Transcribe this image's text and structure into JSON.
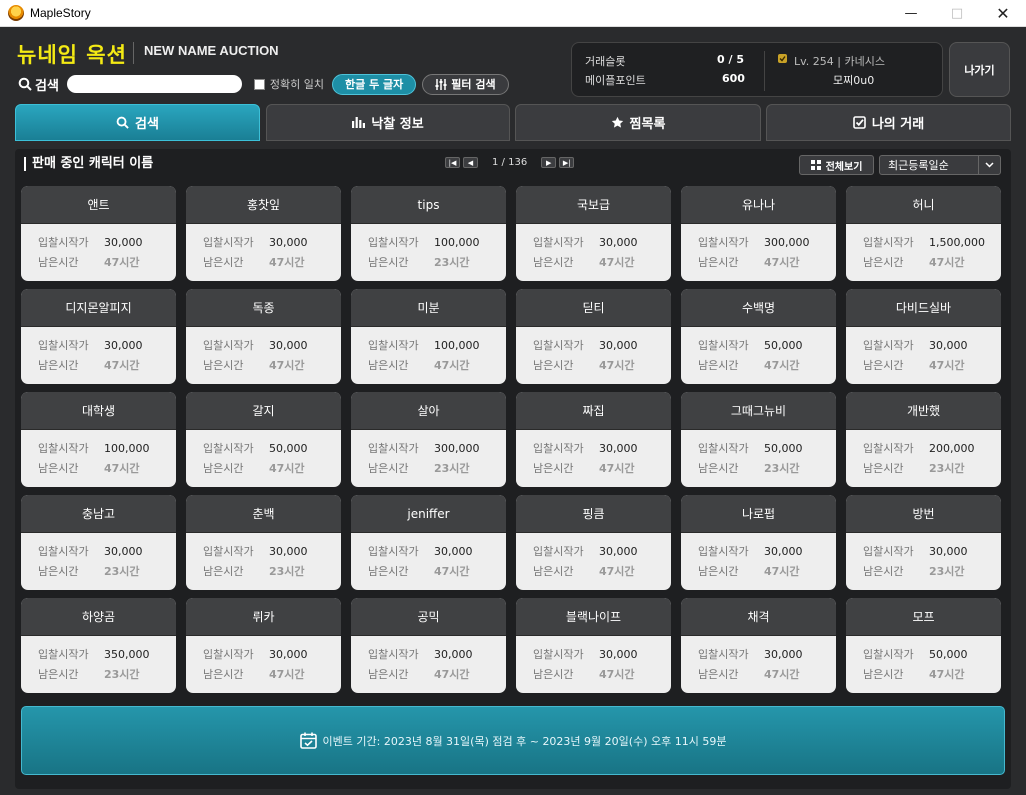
{
  "window": {
    "title": "MapleStory"
  },
  "header": {
    "title": "뉴네임 옥션",
    "subtitle": "NEW NAME AUCTION",
    "search_label": "검색",
    "search_value": "",
    "exact_match_label": "정확히 일치",
    "hangul_two_chars_label": "한글 두 글자",
    "filter_search_label": "필터 검색"
  },
  "info": {
    "trade_slot_label": "거래슬롯",
    "trade_slot_value": "0 / 5",
    "maple_points_label": "메이플포인트",
    "maple_points_value": "600",
    "character_level": "Lv. 254 | 카네시스",
    "character_name": "모찌0u0",
    "exit_label": "나가기"
  },
  "tabs": [
    {
      "label": "검색",
      "icon": "search-icon",
      "active": true
    },
    {
      "label": "낙찰 정보",
      "icon": "bar-chart-icon",
      "active": false
    },
    {
      "label": "찜목록",
      "icon": "star-icon",
      "active": false
    },
    {
      "label": "나의 거래",
      "icon": "checkbox-icon",
      "active": false
    }
  ],
  "list": {
    "title": "판매 중인 캐릭터 이름",
    "page_text": "1 / 136",
    "view_all_label": "전체보기",
    "sort_value": "최근등록일순",
    "bid_label": "입찰시작가",
    "time_label": "남은시간",
    "items": [
      {
        "name": "앤트",
        "price": "30,000",
        "time": "47시간"
      },
      {
        "name": "홍찻잎",
        "price": "30,000",
        "time": "47시간"
      },
      {
        "name": "tips",
        "price": "100,000",
        "time": "23시간"
      },
      {
        "name": "국보급",
        "price": "30,000",
        "time": "47시간"
      },
      {
        "name": "유나나",
        "price": "300,000",
        "time": "47시간"
      },
      {
        "name": "허니",
        "price": "1,500,000",
        "time": "47시간"
      },
      {
        "name": "디지몬알피지",
        "price": "30,000",
        "time": "47시간"
      },
      {
        "name": "독종",
        "price": "30,000",
        "time": "47시간"
      },
      {
        "name": "미분",
        "price": "100,000",
        "time": "47시간"
      },
      {
        "name": "딛티",
        "price": "30,000",
        "time": "47시간"
      },
      {
        "name": "수백명",
        "price": "50,000",
        "time": "47시간"
      },
      {
        "name": "다비드실바",
        "price": "30,000",
        "time": "47시간"
      },
      {
        "name": "대학생",
        "price": "100,000",
        "time": "47시간"
      },
      {
        "name": "갈지",
        "price": "50,000",
        "time": "47시간"
      },
      {
        "name": "살아",
        "price": "300,000",
        "time": "23시간"
      },
      {
        "name": "짜집",
        "price": "30,000",
        "time": "47시간"
      },
      {
        "name": "그때그뉴비",
        "price": "50,000",
        "time": "23시간"
      },
      {
        "name": "개반했",
        "price": "200,000",
        "time": "23시간"
      },
      {
        "name": "충남고",
        "price": "30,000",
        "time": "23시간"
      },
      {
        "name": "춘백",
        "price": "30,000",
        "time": "23시간"
      },
      {
        "name": "jeniffer",
        "price": "30,000",
        "time": "47시간"
      },
      {
        "name": "핑큼",
        "price": "30,000",
        "time": "47시간"
      },
      {
        "name": "나로펍",
        "price": "30,000",
        "time": "47시간"
      },
      {
        "name": "방번",
        "price": "30,000",
        "time": "23시간"
      },
      {
        "name": "하양곰",
        "price": "350,000",
        "time": "23시간"
      },
      {
        "name": "뤼카",
        "price": "30,000",
        "time": "47시간"
      },
      {
        "name": "공믹",
        "price": "30,000",
        "time": "47시간"
      },
      {
        "name": "블랙나이프",
        "price": "30,000",
        "time": "47시간"
      },
      {
        "name": "채격",
        "price": "30,000",
        "time": "47시간"
      },
      {
        "name": "모프",
        "price": "50,000",
        "time": "47시간"
      }
    ]
  },
  "event": {
    "text": "이벤트 기간: 2023년 8월 31일(목) 점검 후 ~ 2023년 9월 20일(수) 오후 11시 59분",
    "icon": "calendar-icon"
  },
  "colors": {
    "accent": "#1e8fa6",
    "brand_yellow": "#f4ea14",
    "panel_bg": "#1e1f21"
  }
}
